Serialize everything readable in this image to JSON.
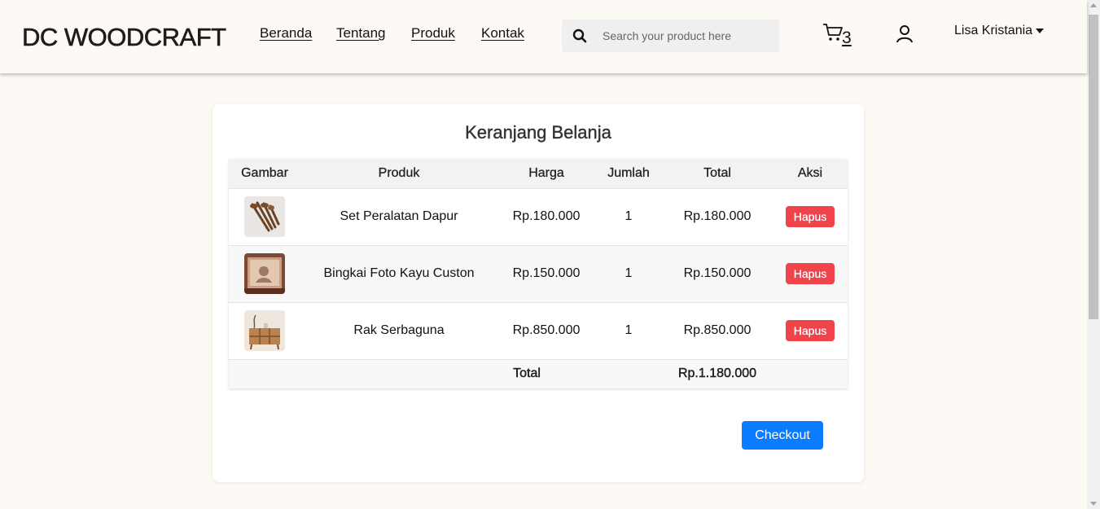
{
  "header": {
    "logo": "DC WOODCRAFT",
    "nav": [
      "Beranda",
      "Tentang",
      "Produk",
      "Kontak"
    ],
    "search_placeholder": "Search your product here",
    "cart_count": "3",
    "user_name": "Lisa Kristania"
  },
  "cart": {
    "title": "Keranjang Belanja",
    "columns": [
      "Gambar",
      "Produk",
      "Harga",
      "Jumlah",
      "Total",
      "Aksi"
    ],
    "items": [
      {
        "name": "Set Peralatan Dapur",
        "price": "Rp.180.000",
        "qty": "1",
        "total": "Rp.180.000",
        "action": "Hapus"
      },
      {
        "name": "Bingkai Foto Kayu Custon",
        "price": "Rp.150.000",
        "qty": "1",
        "total": "Rp.150.000",
        "action": "Hapus"
      },
      {
        "name": "Rak Serbaguna",
        "price": "Rp.850.000",
        "qty": "1",
        "total": "Rp.850.000",
        "action": "Hapus"
      }
    ],
    "footer_label": "Total",
    "grand_total": "Rp.1.180.000",
    "checkout_label": "Checkout"
  },
  "colors": {
    "background": "#fdf9f4",
    "danger": "#f0444a",
    "primary": "#0b7cff"
  }
}
